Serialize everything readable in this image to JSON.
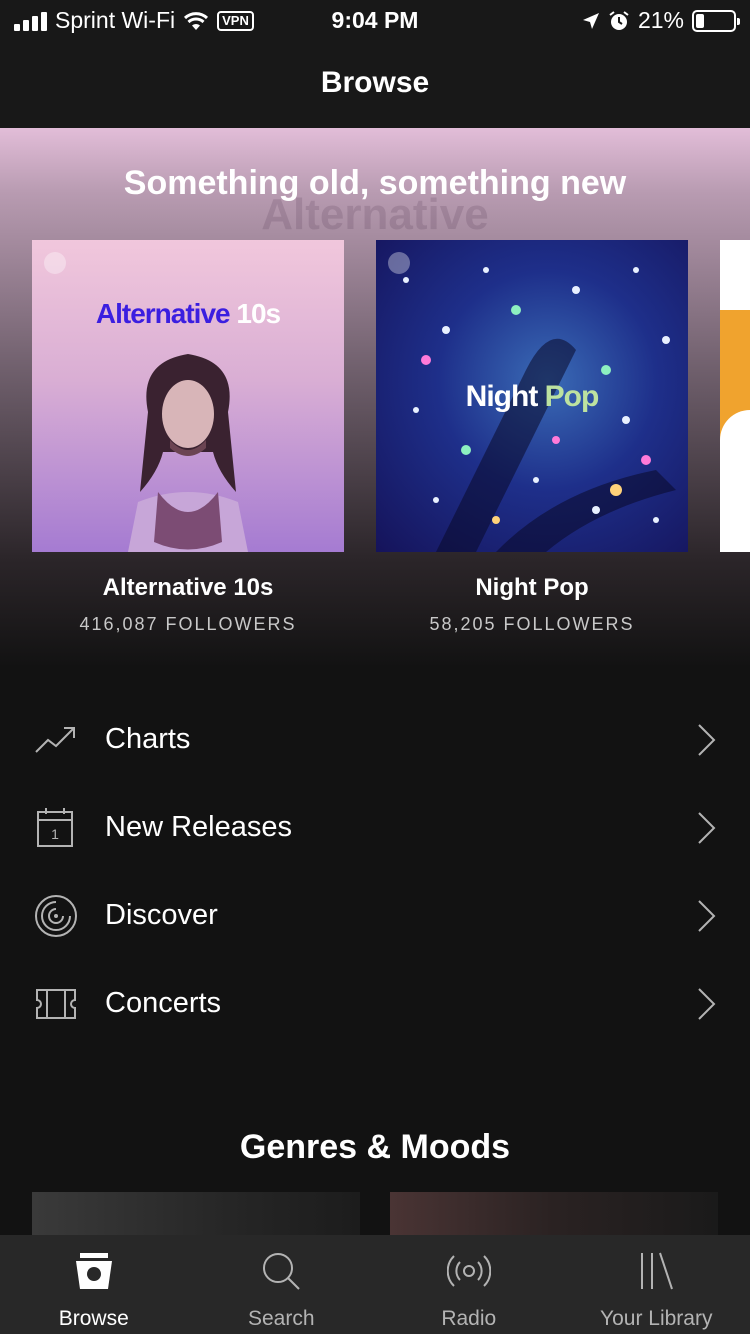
{
  "status_bar": {
    "carrier": "Sprint Wi-Fi",
    "vpn": "VPN",
    "time": "9:04 PM",
    "battery_percent": "21%",
    "battery_level": 0.21
  },
  "nav": {
    "title": "Browse"
  },
  "hero": {
    "title": "Something old, something new",
    "ghost_text": "Alternative",
    "playlists": [
      {
        "name": "Alternative 10s",
        "followers": "416,087 FOLLOWERS",
        "art_title_main": "Alternative ",
        "art_title_tail": "10s"
      },
      {
        "name": "Night Pop",
        "followers": "58,205 FOLLOWERS",
        "art_title_main": "Night ",
        "art_title_tail": "Pop"
      }
    ]
  },
  "menu": {
    "items": [
      {
        "label": "Charts",
        "icon": "trending-up-icon"
      },
      {
        "label": "New Releases",
        "icon": "calendar-icon",
        "icon_text": "1"
      },
      {
        "label": "Discover",
        "icon": "discover-icon"
      },
      {
        "label": "Concerts",
        "icon": "ticket-icon"
      }
    ]
  },
  "genres": {
    "title": "Genres & Moods"
  },
  "tabs": [
    {
      "label": "Browse",
      "icon": "browse-icon",
      "active": true
    },
    {
      "label": "Search",
      "icon": "search-icon",
      "active": false
    },
    {
      "label": "Radio",
      "icon": "radio-icon",
      "active": false
    },
    {
      "label": "Your Library",
      "icon": "library-icon",
      "active": false
    }
  ],
  "colors": {
    "background": "#121212",
    "bar": "#181818",
    "tab_bar": "#282828",
    "text_secondary": "#b3b3b3",
    "alt_title": "#3b1ee0"
  }
}
